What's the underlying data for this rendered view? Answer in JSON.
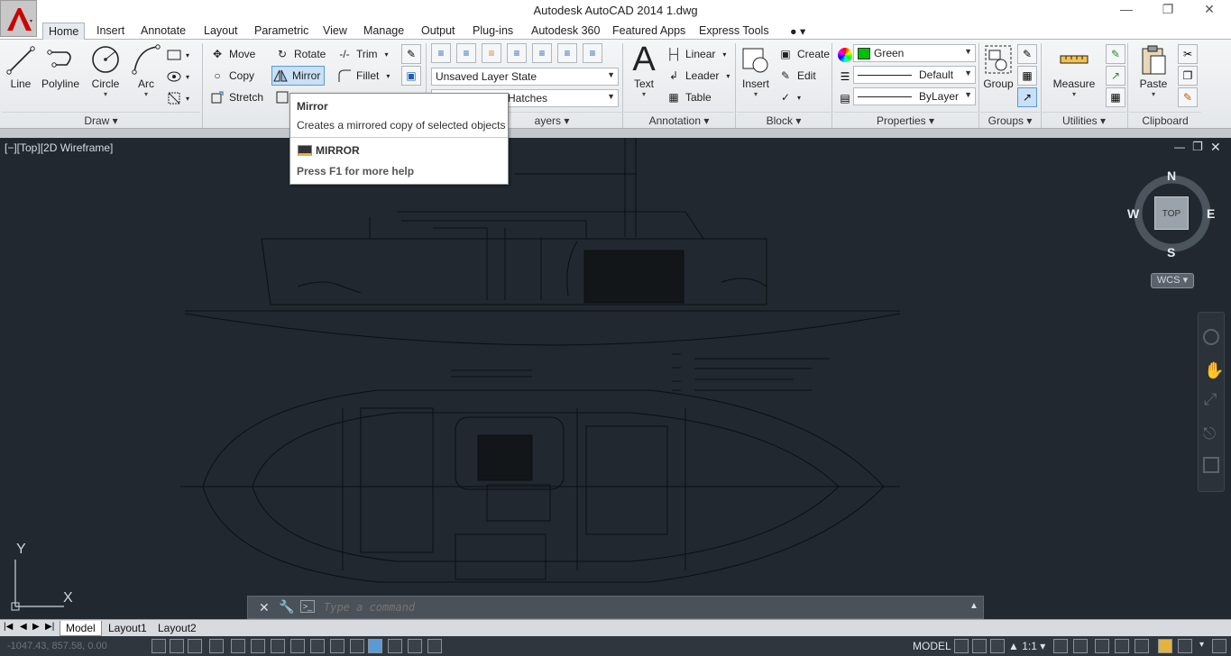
{
  "titlebar": {
    "title": "Autodesk AutoCAD 2014    1.dwg"
  },
  "tabs": [
    "Home",
    "Insert",
    "Annotate",
    "Layout",
    "Parametric",
    "View",
    "Manage",
    "Output",
    "Plug-ins",
    "Autodesk 360",
    "Featured Apps",
    "Express Tools"
  ],
  "draw": {
    "line": "Line",
    "polyline": "Polyline",
    "circle": "Circle",
    "arc": "Arc",
    "title": "Draw"
  },
  "modify": {
    "move": "Move",
    "rotate": "Rotate",
    "trim": "Trim",
    "copy": "Copy",
    "mirror": "Mirror",
    "fillet": "Fillet",
    "stretch": "Stretch"
  },
  "layers": {
    "state": "Unsaved Layer State",
    "layer": "Hatches",
    "title": "ayers"
  },
  "annotation": {
    "text": "Text",
    "linear": "Linear",
    "leader": "Leader",
    "table": "Table",
    "title": "Annotation"
  },
  "block": {
    "insert": "Insert",
    "create": "Create",
    "edit": "Edit",
    "title": "Block"
  },
  "properties": {
    "color": "Green",
    "linetype": "Default",
    "lineweight": "ByLayer",
    "title": "Properties"
  },
  "groups": {
    "group": "Group",
    "title": "Groups"
  },
  "utilities": {
    "measure": "Measure",
    "title": "Utilities"
  },
  "clipboard": {
    "paste": "Paste",
    "title": "Clipboard"
  },
  "tooltip": {
    "title": "Mirror",
    "desc": "Creates a mirrored copy of selected objects",
    "command": "MIRROR",
    "help": "Press F1 for more help"
  },
  "viewport": {
    "label": "[−][Top][2D Wireframe]"
  },
  "viewcube": {
    "n": "N",
    "s": "S",
    "e": "E",
    "w": "W",
    "face": "TOP",
    "wcs": "WCS"
  },
  "ucs": {
    "y": "Y",
    "x": "X"
  },
  "command": {
    "placeholder": "Type a command"
  },
  "layouts": [
    "Model",
    "Layout1",
    "Layout2"
  ],
  "status": {
    "coords": "-1047.43, 857.58, 0.00",
    "model": "MODEL",
    "scale": "1:1"
  },
  "colors": {
    "green": "#00c000",
    "accent": "#5b9bd5",
    "canvas": "#212830"
  },
  "icons": [
    "app-menu-icon",
    "minimize-icon",
    "restore-icon",
    "close-icon",
    "line-icon",
    "polyline-icon",
    "circle-icon",
    "arc-icon",
    "move-icon",
    "rotate-icon",
    "trim-icon",
    "copy-icon",
    "mirror-icon",
    "fillet-icon",
    "stretch-icon",
    "text-icon",
    "insert-icon",
    "group-icon",
    "measure-icon",
    "paste-icon",
    "wrench-icon",
    "viewcube-icon"
  ]
}
